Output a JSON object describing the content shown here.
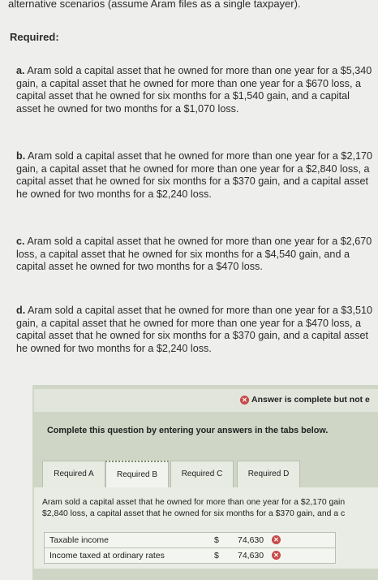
{
  "intro_text": "alternative scenarios (assume Aram files as a single taxpayer).",
  "required_label": "Required:",
  "scenarios": [
    {
      "letter": "a.",
      "text": "Aram sold a capital asset that he owned for more than one year for a $5,340 gain, a capital asset that he owned for more than one year for a $670 loss, a capital asset that he owned for six months for a $1,540 gain, and a capital asset he owned for two months for a $1,070 loss."
    },
    {
      "letter": "b.",
      "text": "Aram sold a capital asset that he owned for more than one year for a $2,170 gain, a capital asset that he owned for more than one year for a $2,840 loss, a capital asset that he owned for six months for a $370 gain, and a capital asset he owned for two months for a $2,240 loss."
    },
    {
      "letter": "c.",
      "text": "Aram sold a capital asset that he owned for more than one year for a $2,670 loss, a capital asset that he owned for six months for a $4,540 gain, and a capital asset he owned for two months for a $470 loss."
    },
    {
      "letter": "d.",
      "text": "Aram sold a capital asset that he owned for more than one year for a $3,510 gain, a capital asset that he owned for more than one year for a $470 loss, a capital asset that he owned for six months for a $370 gain, and a capital asset he owned for two months for a $2,240 loss."
    }
  ],
  "answer_status": "Answer is complete but not e",
  "instructions": "Complete this question by entering your answers in the tabs below.",
  "tabs": [
    "Required A",
    "Required B",
    "Required C",
    "Required D"
  ],
  "active_tab": "Required B",
  "question_line1": "Aram sold a capital asset that he owned for more than one year for a $2,170 gain",
  "question_line2": "$2,840 loss, a capital asset that he owned for six months for a $370 gain, and a c",
  "table": [
    {
      "label": "Taxable income",
      "currency": "$",
      "value": "74,630",
      "status_icon": "x-icon"
    },
    {
      "label": "Income taxed at ordinary rates",
      "currency": "$",
      "value": "74,630",
      "status_icon": "x-icon"
    }
  ],
  "colors": {
    "incorrect": "#c84a4a",
    "panel": "#cfd6c6"
  }
}
